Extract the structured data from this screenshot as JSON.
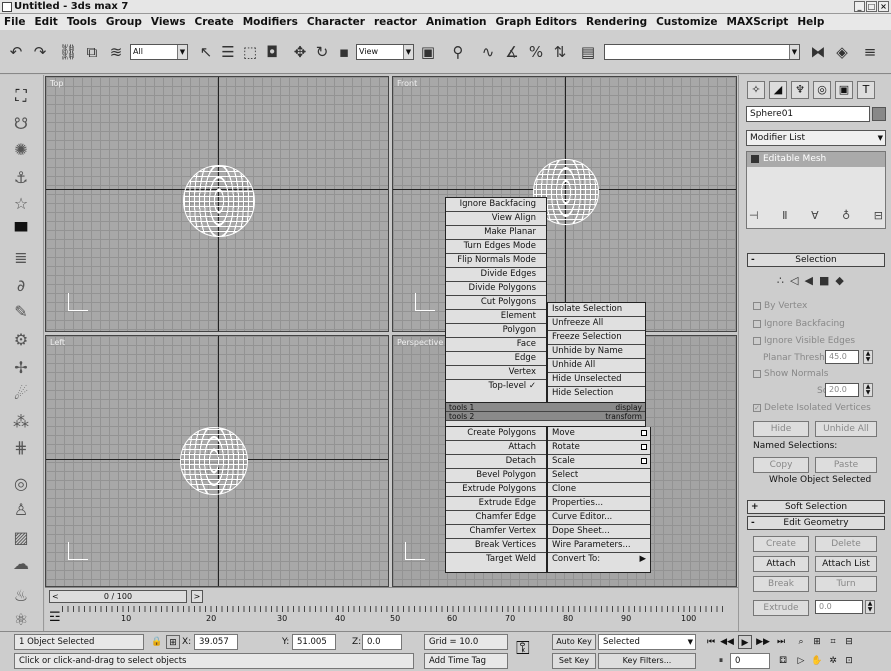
{
  "title": "Untitled - 3ds max 7",
  "menu": [
    "File",
    "Edit",
    "Tools",
    "Group",
    "Views",
    "Create",
    "Modifiers",
    "Character",
    "reactor",
    "Animation",
    "Graph Editors",
    "Rendering",
    "Customize",
    "MAXScript",
    "Help"
  ],
  "toolbar": {
    "selection_filter": "All",
    "coord_system": "View"
  },
  "viewports": {
    "top": "Top",
    "front": "Front",
    "left": "Left",
    "perspective": "Perspective"
  },
  "quad_menu": {
    "left_top": [
      "Ignore Backfacing",
      "View Align",
      "Make Planar",
      "Turn Edges Mode",
      "Flip Normals Mode",
      "Divide Edges",
      "Divide Polygons",
      "Cut Polygons",
      "Element",
      "Polygon",
      "Face",
      "Edge",
      "Vertex",
      "Top-level ✓"
    ],
    "right_top": [
      "Isolate Selection",
      "Unfreeze All",
      "Freeze Selection",
      "Unhide by Name",
      "Unhide All",
      "Hide Unselected",
      "Hide Selection"
    ],
    "quad_labels": {
      "tools1": "tools 1",
      "display": "display",
      "tools2": "tools 2",
      "transform": "transform"
    },
    "left_bottom": [
      "Create Polygons",
      "Attach",
      "Detach",
      "Bevel Polygon",
      "Extrude Polygons",
      "Extrude Edge",
      "Chamfer Edge",
      "Chamfer Vertex",
      "Break Vertices",
      "Target Weld"
    ],
    "right_bottom": [
      "Move",
      "Rotate",
      "Scale",
      "Select",
      "Clone",
      "Properties...",
      "Curve Editor...",
      "Dope Sheet...",
      "Wire Parameters...",
      "Convert To:"
    ]
  },
  "command_panel": {
    "object_name": "Sphere01",
    "modifier_list": "Modifier List",
    "stack_item": "Editable Mesh",
    "selection_title": "Selection",
    "by_vertex": "By Vertex",
    "ignore_backfacing": "Ignore Backfacing",
    "ignore_visible_edges": "Ignore Visible Edges",
    "planar_thresh_label": "Planar Thresh:",
    "planar_thresh": "45.0",
    "show_normals": "Show Normals",
    "scale_label": "Scale:",
    "scale": "20.0",
    "delete_isolated": "Delete Isolated Vertices",
    "hide": "Hide",
    "unhide_all": "Unhide All",
    "named_selections": "Named Selections:",
    "copy": "Copy",
    "paste": "Paste",
    "whole_object": "Whole Object Selected",
    "soft_selection": "Soft Selection",
    "edit_geometry": "Edit Geometry",
    "create": "Create",
    "delete": "Delete",
    "attach": "Attach",
    "attach_list": "Attach List",
    "break": "Break",
    "turn": "Turn",
    "extrude": "Extrude",
    "extrude_val": "0.0"
  },
  "timeline": {
    "slider": "0 / 100",
    "ticks": [
      "0",
      "10",
      "20",
      "30",
      "40",
      "50",
      "60",
      "70",
      "80",
      "90",
      "100"
    ]
  },
  "status": {
    "selected": "1 Object Selected",
    "prompt": "Click or click-and-drag to select objects",
    "x_label": "X:",
    "x": "39.057",
    "y_label": "Y:",
    "y": "51.005",
    "z_label": "Z:",
    "z": "0.0",
    "grid": "Grid = 10.0",
    "add_time_tag": "Add Time Tag",
    "auto_key": "Auto Key",
    "set_key": "Set Key",
    "selected_dropdown": "Selected",
    "key_filters": "Key Filters...",
    "frame": "0"
  }
}
